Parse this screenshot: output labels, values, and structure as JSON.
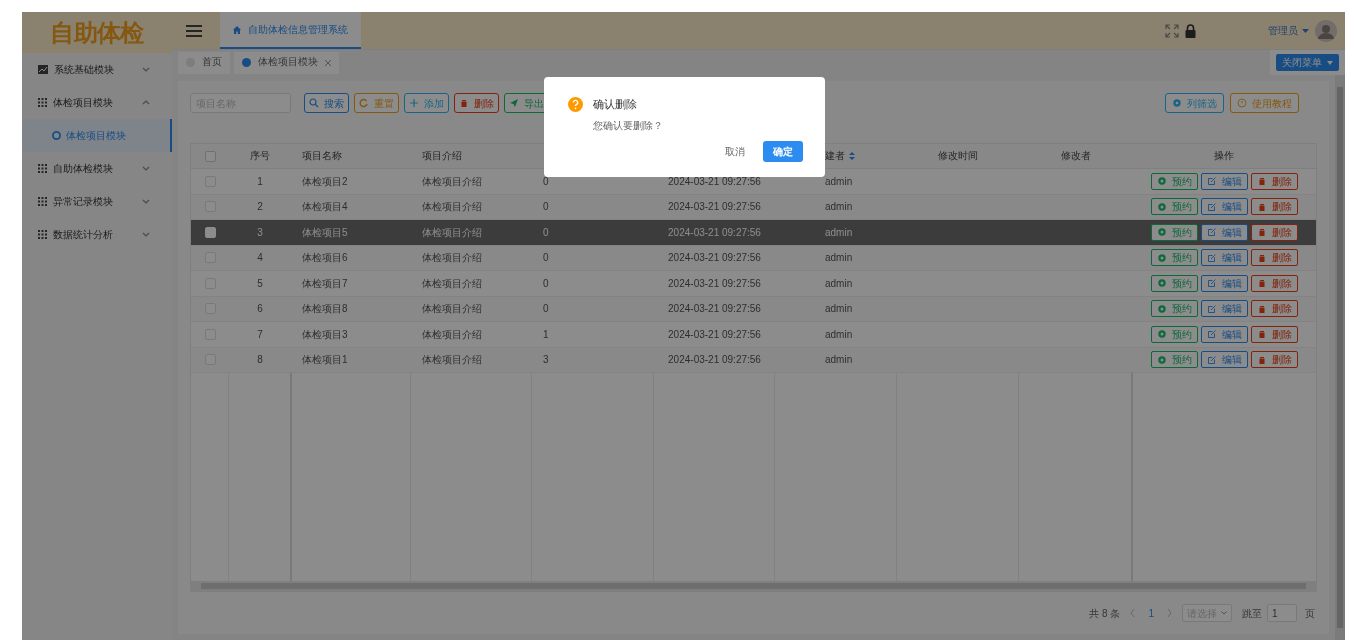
{
  "sidebar": {
    "logo": "自助体检",
    "items": [
      {
        "label": "系统基础模块",
        "expanded": false
      },
      {
        "label": "体检项目模块",
        "expanded": true,
        "children": [
          {
            "label": "体检项目模块",
            "selected": true
          }
        ]
      },
      {
        "label": "自助体检模块",
        "expanded": false
      },
      {
        "label": "异常记录模块",
        "expanded": false
      },
      {
        "label": "数据统计分析",
        "expanded": false
      }
    ]
  },
  "header": {
    "tabs": [
      {
        "label": "自助体检信息管理系统",
        "selected": true
      }
    ],
    "user": "管理员"
  },
  "tag_tabs": [
    {
      "label": "首页",
      "selected": false,
      "closable": false
    },
    {
      "label": "体检项目模块",
      "selected": true,
      "closable": true
    }
  ],
  "close_menu_button": "关闭菜单",
  "toolbar": {
    "search": {
      "placeholder": "项目名称"
    },
    "buttons": [
      {
        "label": "搜索",
        "kind": "search"
      },
      {
        "label": "重置",
        "kind": "reset"
      },
      {
        "label": "添加",
        "kind": "add"
      },
      {
        "label": "删除",
        "kind": "delete"
      },
      {
        "label": "导出",
        "kind": "export"
      }
    ],
    "right_buttons": [
      {
        "label": "列筛选",
        "kind": "filter"
      },
      {
        "label": "使用教程",
        "kind": "help"
      }
    ]
  },
  "table": {
    "all_selected": false,
    "columns": [
      {
        "label": "序号",
        "kind": "center"
      },
      {
        "label": "项目名称",
        "kind": "left"
      },
      {
        "label": "项目介绍",
        "kind": "left"
      },
      {
        "kind": "left"
      },
      {
        "kind": "center"
      },
      {
        "label": "建者",
        "kind": "sort"
      },
      {
        "label": "修改时间",
        "kind": "center"
      },
      {
        "label": "修改者",
        "kind": "center"
      },
      {
        "label": "操作",
        "kind": "center"
      }
    ],
    "rows": [
      {
        "selected": false,
        "cells": [
          "1",
          "体检项目2",
          "体检项目介绍",
          "0",
          "2024-03-21 09:27:56",
          "admin"
        ],
        "actions": [
          {
            "label": "预约",
            "kind": "book"
          },
          {
            "label": "编辑",
            "kind": "edit"
          },
          {
            "label": "删除",
            "kind": "delete"
          }
        ]
      },
      {
        "selected": false,
        "cells": [
          "2",
          "体检项目4",
          "体检项目介绍",
          "0",
          "2024-03-21 09:27:56",
          "admin"
        ],
        "actions": [
          {
            "label": "预约",
            "kind": "book"
          },
          {
            "label": "编辑",
            "kind": "edit"
          },
          {
            "label": "删除",
            "kind": "delete"
          }
        ]
      },
      {
        "selected": true,
        "cells": [
          "3",
          "体检项目5",
          "体检项目介绍",
          "0",
          "2024-03-21 09:27:56",
          "admin"
        ],
        "actions": [
          {
            "label": "预约",
            "kind": "book"
          },
          {
            "label": "编辑",
            "kind": "edit"
          },
          {
            "label": "删除",
            "kind": "delete"
          }
        ]
      },
      {
        "selected": false,
        "cells": [
          "4",
          "体检项目6",
          "体检项目介绍",
          "0",
          "2024-03-21 09:27:56",
          "admin"
        ],
        "actions": [
          {
            "label": "预约",
            "kind": "book"
          },
          {
            "label": "编辑",
            "kind": "edit"
          },
          {
            "label": "删除",
            "kind": "delete"
          }
        ]
      },
      {
        "selected": false,
        "cells": [
          "5",
          "体检项目7",
          "体检项目介绍",
          "0",
          "2024-03-21 09:27:56",
          "admin"
        ],
        "actions": [
          {
            "label": "预约",
            "kind": "book"
          },
          {
            "label": "编辑",
            "kind": "edit"
          },
          {
            "label": "删除",
            "kind": "delete"
          }
        ]
      },
      {
        "selected": false,
        "cells": [
          "6",
          "体检项目8",
          "体检项目介绍",
          "0",
          "2024-03-21 09:27:56",
          "admin"
        ],
        "actions": [
          {
            "label": "预约",
            "kind": "book"
          },
          {
            "label": "编辑",
            "kind": "edit"
          },
          {
            "label": "删除",
            "kind": "delete"
          }
        ]
      },
      {
        "selected": false,
        "cells": [
          "7",
          "体检项目3",
          "体检项目介绍",
          "1",
          "2024-03-21 09:27:56",
          "admin"
        ],
        "actions": [
          {
            "label": "预约",
            "kind": "book"
          },
          {
            "label": "编辑",
            "kind": "edit"
          },
          {
            "label": "删除",
            "kind": "delete"
          }
        ]
      },
      {
        "selected": false,
        "cells": [
          "8",
          "体检项目1",
          "体检项目介绍",
          "3",
          "2024-03-21 09:27:56",
          "admin"
        ],
        "actions": [
          {
            "label": "预约",
            "kind": "book"
          },
          {
            "label": "编辑",
            "kind": "edit"
          },
          {
            "label": "删除",
            "kind": "delete"
          }
        ]
      }
    ]
  },
  "pagination": {
    "total": "共 8 条",
    "page": "1",
    "page_size": {
      "placeholder": "请选择"
    },
    "jump_label": "跳至",
    "jump_value": "1",
    "suffix": "页"
  },
  "dialog": {
    "title": "确认删除",
    "message": "您确认要删除？",
    "cancel": "取消",
    "confirm": "确定"
  }
}
